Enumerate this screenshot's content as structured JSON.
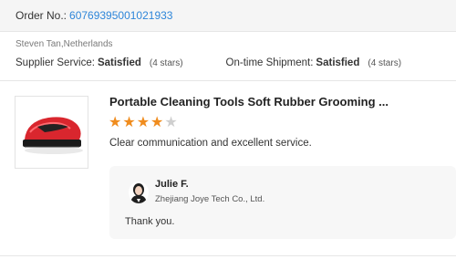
{
  "order": {
    "label": "Order No.:",
    "number": "60769395001021933"
  },
  "buyer": {
    "name_country": "Steven Tan,Netherlands"
  },
  "ratings": {
    "supplier_service": {
      "label": "Supplier Service:",
      "value": "Satisfied",
      "stars_text": "(4 stars)"
    },
    "on_time_shipment": {
      "label": "On-time Shipment:",
      "value": "Satisfied",
      "stars_text": "(4 stars)"
    }
  },
  "product": {
    "title": "Portable Cleaning Tools Soft Rubber Grooming ...",
    "image_icon": "red-rubber-brush",
    "rating": 4,
    "rating_max": 5,
    "review": "Clear communication and excellent service."
  },
  "reply": {
    "name": "Julie F.",
    "company": "Zhejiang Joye Tech Co., Ltd.",
    "text": "Thank you."
  },
  "colors": {
    "link": "#2e86d9",
    "star_on": "#f08c1e",
    "star_off": "#cfcfcf",
    "product_red": "#d9262e"
  }
}
